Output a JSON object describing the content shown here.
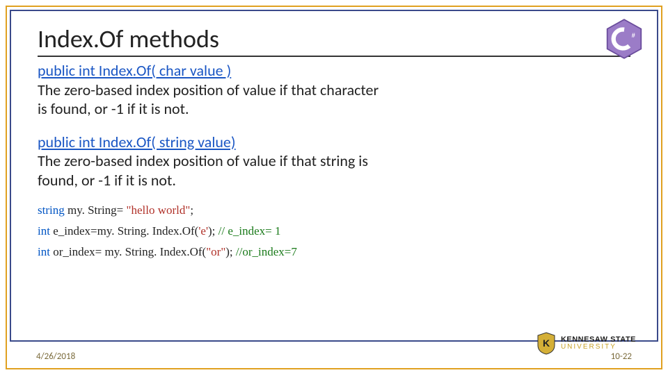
{
  "title": "Index.Of methods",
  "method1": {
    "signature": "public int Index.Of( char value )",
    "desc1": "The zero-based index position of value if that character",
    "desc2": " is found, or -1 if it is not."
  },
  "method2": {
    "signature": "public int Index.Of( string value)",
    "desc1": "The zero-based index position of value if that string is",
    "desc2": " found, or -1 if it is not."
  },
  "code": {
    "l1_kw": "string",
    "l1_rest": " my. String= ",
    "l1_str": "\"hello world\"",
    "l1_end": ";",
    "l2_kw": "int",
    "l2_rest": " e_index=my. String. Index.Of(",
    "l2_str": "'e'",
    "l2_mid": ");  ",
    "l2_cmt": "// e_index= 1",
    "l3_kw": "int",
    "l3_rest": " or_index= my. String. Index.Of(",
    "l3_str": "\"or\"",
    "l3_mid": "); ",
    "l3_cmt": "//or_index=7"
  },
  "footer": {
    "date": "4/26/2018",
    "page": "10-22"
  },
  "logo": {
    "name": "csharp-icon"
  },
  "ksu": {
    "line1": "KENNESAW STATE",
    "line2": "UNIVERSITY"
  }
}
